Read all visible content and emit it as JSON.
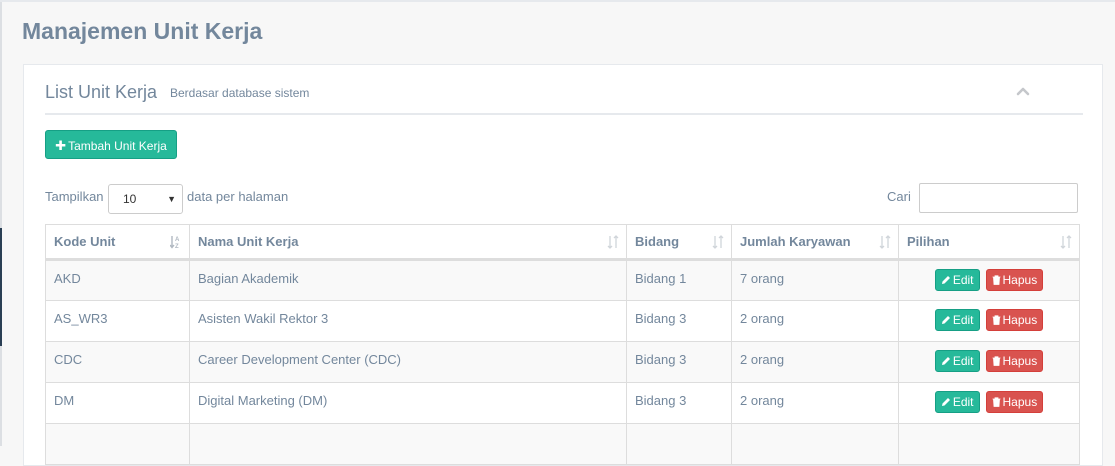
{
  "page": {
    "title": "Manajemen Unit Kerja"
  },
  "panel": {
    "title": "List Unit Kerja",
    "subtitle": "Berdasar database sistem",
    "collapse_icon": "chevron-up-icon"
  },
  "toolbar": {
    "add_label": "Tambah Unit Kerja",
    "add_icon": "plus-icon"
  },
  "table_controls": {
    "length_prefix": "Tampilkan",
    "length_value": "10",
    "length_suffix": "data per halaman",
    "search_label": "Cari",
    "search_value": ""
  },
  "table": {
    "columns": [
      {
        "label": "Kode Unit",
        "sort_icon": "sort-alpha-asc-icon"
      },
      {
        "label": "Nama Unit Kerja",
        "sort_icon": "sort-icon"
      },
      {
        "label": "Bidang",
        "sort_icon": "sort-icon"
      },
      {
        "label": "Jumlah Karyawan",
        "sort_icon": "sort-icon"
      },
      {
        "label": "Pilihan",
        "sort_icon": "sort-icon"
      }
    ],
    "rows": [
      {
        "kode": "AKD",
        "nama": "Bagian Akademik",
        "bidang": "Bidang 1",
        "jumlah": "7 orang",
        "edit_label": "Edit",
        "delete_label": "Hapus"
      },
      {
        "kode": "AS_WR3",
        "nama": "Asisten Wakil Rektor 3",
        "bidang": "Bidang 3",
        "jumlah": "2 orang",
        "edit_label": "Edit",
        "delete_label": "Hapus"
      },
      {
        "kode": "CDC",
        "nama": "Career Development Center (CDC)",
        "bidang": "Bidang 3",
        "jumlah": "2 orang",
        "edit_label": "Edit",
        "delete_label": "Hapus"
      },
      {
        "kode": "DM",
        "nama": "Digital Marketing (DM)",
        "bidang": "Bidang 3",
        "jumlah": "2 orang",
        "edit_label": "Edit",
        "delete_label": "Hapus"
      },
      {
        "kode": "",
        "nama": "",
        "bidang": "",
        "jumlah": "",
        "edit_label": "",
        "delete_label": ""
      }
    ]
  },
  "colors": {
    "primary_green": "#26b99a",
    "danger_red": "#d9534f",
    "text": "#73879c",
    "background": "#f7f7f7"
  }
}
